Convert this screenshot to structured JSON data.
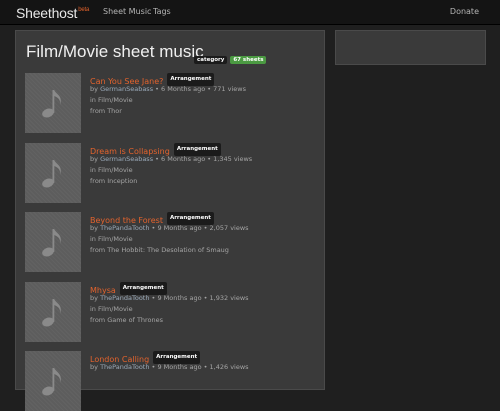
{
  "header": {
    "logo": "Sheethost",
    "beta": "beta",
    "nav": {
      "sheet_music": "Sheet Music",
      "tags": "Tags",
      "donate": "Donate"
    }
  },
  "page": {
    "title": "Film/Movie sheet music",
    "category_badge": "category",
    "count_badge": "67 sheets"
  },
  "items": [
    {
      "title": "Can You See Jane?",
      "badge": "Arrangement",
      "by": "by",
      "author": "GermanSeabass",
      "details": " • 6 Months ago • 771 views",
      "category": "in Film/Movie",
      "source": "from Thor"
    },
    {
      "title": "Dream is Collapsing",
      "badge": "Arrangement",
      "by": "by",
      "author": "GermanSeabass",
      "details": " • 6 Months ago • 1,345 views",
      "category": "in Film/Movie",
      "source": "from Inception"
    },
    {
      "title": "Beyond the Forest",
      "badge": "Arrangement",
      "by": "by",
      "author": "ThePandaTooth",
      "details": " • 9 Months ago • 2,057 views",
      "category": "in Film/Movie",
      "source": "from The Hobbit: The Desolation of Smaug"
    },
    {
      "title": "Mhysa",
      "badge": "Arrangement",
      "by": "by",
      "author": "ThePandaTooth",
      "details": " • 9 Months ago • 1,932 views",
      "category": "in Film/Movie",
      "source": "from Game of Thrones"
    },
    {
      "title": "London Calling",
      "badge": "Arrangement",
      "by": "by",
      "author": "ThePandaTooth",
      "details": " • 9 Months ago • 1,426 views",
      "category": "",
      "source": ""
    }
  ]
}
